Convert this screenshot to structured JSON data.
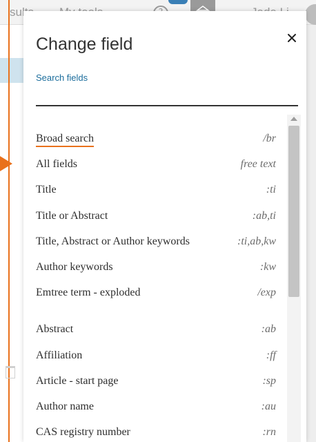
{
  "background": {
    "nav_left_text": "sults",
    "nav_tools_text": "My tools",
    "help_icon_text": "?",
    "user_name": "Jade Li"
  },
  "dialog": {
    "title": "Change field",
    "search_label": "Search fields",
    "search_input_value": "",
    "search_input_placeholder": ""
  },
  "fields": [
    {
      "label": "Broad search",
      "code": "/br",
      "selected": true
    },
    {
      "label": "All fields",
      "code": "free text"
    },
    {
      "label": "Title",
      "code": ":ti"
    },
    {
      "label": "Title or Abstract",
      "code": ":ab,ti"
    },
    {
      "label": "Title, Abstract or Author keywords",
      "code": ":ti,ab,kw"
    },
    {
      "label": "Author keywords",
      "code": ":kw"
    },
    {
      "label": "Emtree term - exploded",
      "code": "/exp"
    },
    {
      "label": "Abstract",
      "code": ":ab"
    },
    {
      "label": "Affiliation",
      "code": ":ff"
    },
    {
      "label": "Article - start page",
      "code": ":sp"
    },
    {
      "label": "Author name",
      "code": ":au"
    },
    {
      "label": "CAS registry number",
      "code": ":rn"
    }
  ],
  "colors": {
    "accent_orange": "#e9711c",
    "link_blue": "#1b6d9c",
    "text_dark": "#333333"
  }
}
